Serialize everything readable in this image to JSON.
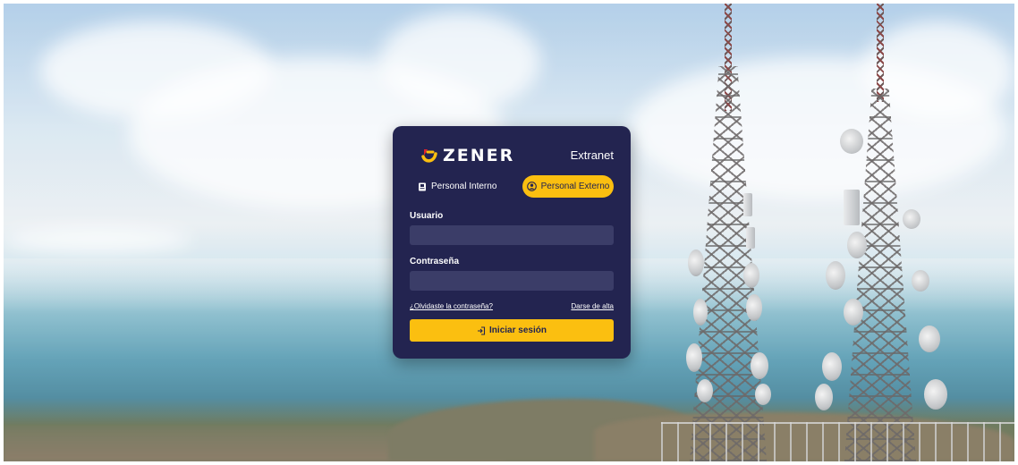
{
  "brand": {
    "name": "ZENER",
    "logo_text": "ZENER",
    "accent": "#fbbf10",
    "primary": "#232450"
  },
  "header": {
    "title": "Extranet"
  },
  "tabs": [
    {
      "label": "Personal Interno",
      "icon": "badge-icon",
      "selected": false
    },
    {
      "label": "Personal Externo",
      "icon": "user-circle-icon",
      "selected": true
    }
  ],
  "form": {
    "username_label": "Usuario",
    "username_value": "",
    "password_label": "Contraseña",
    "password_value": "",
    "forgot_link": "¿Olvidaste la contraseña?",
    "signup_link": "Darse de alta",
    "submit_label": "Iniciar sesión",
    "submit_icon": "login-arrow-icon"
  }
}
